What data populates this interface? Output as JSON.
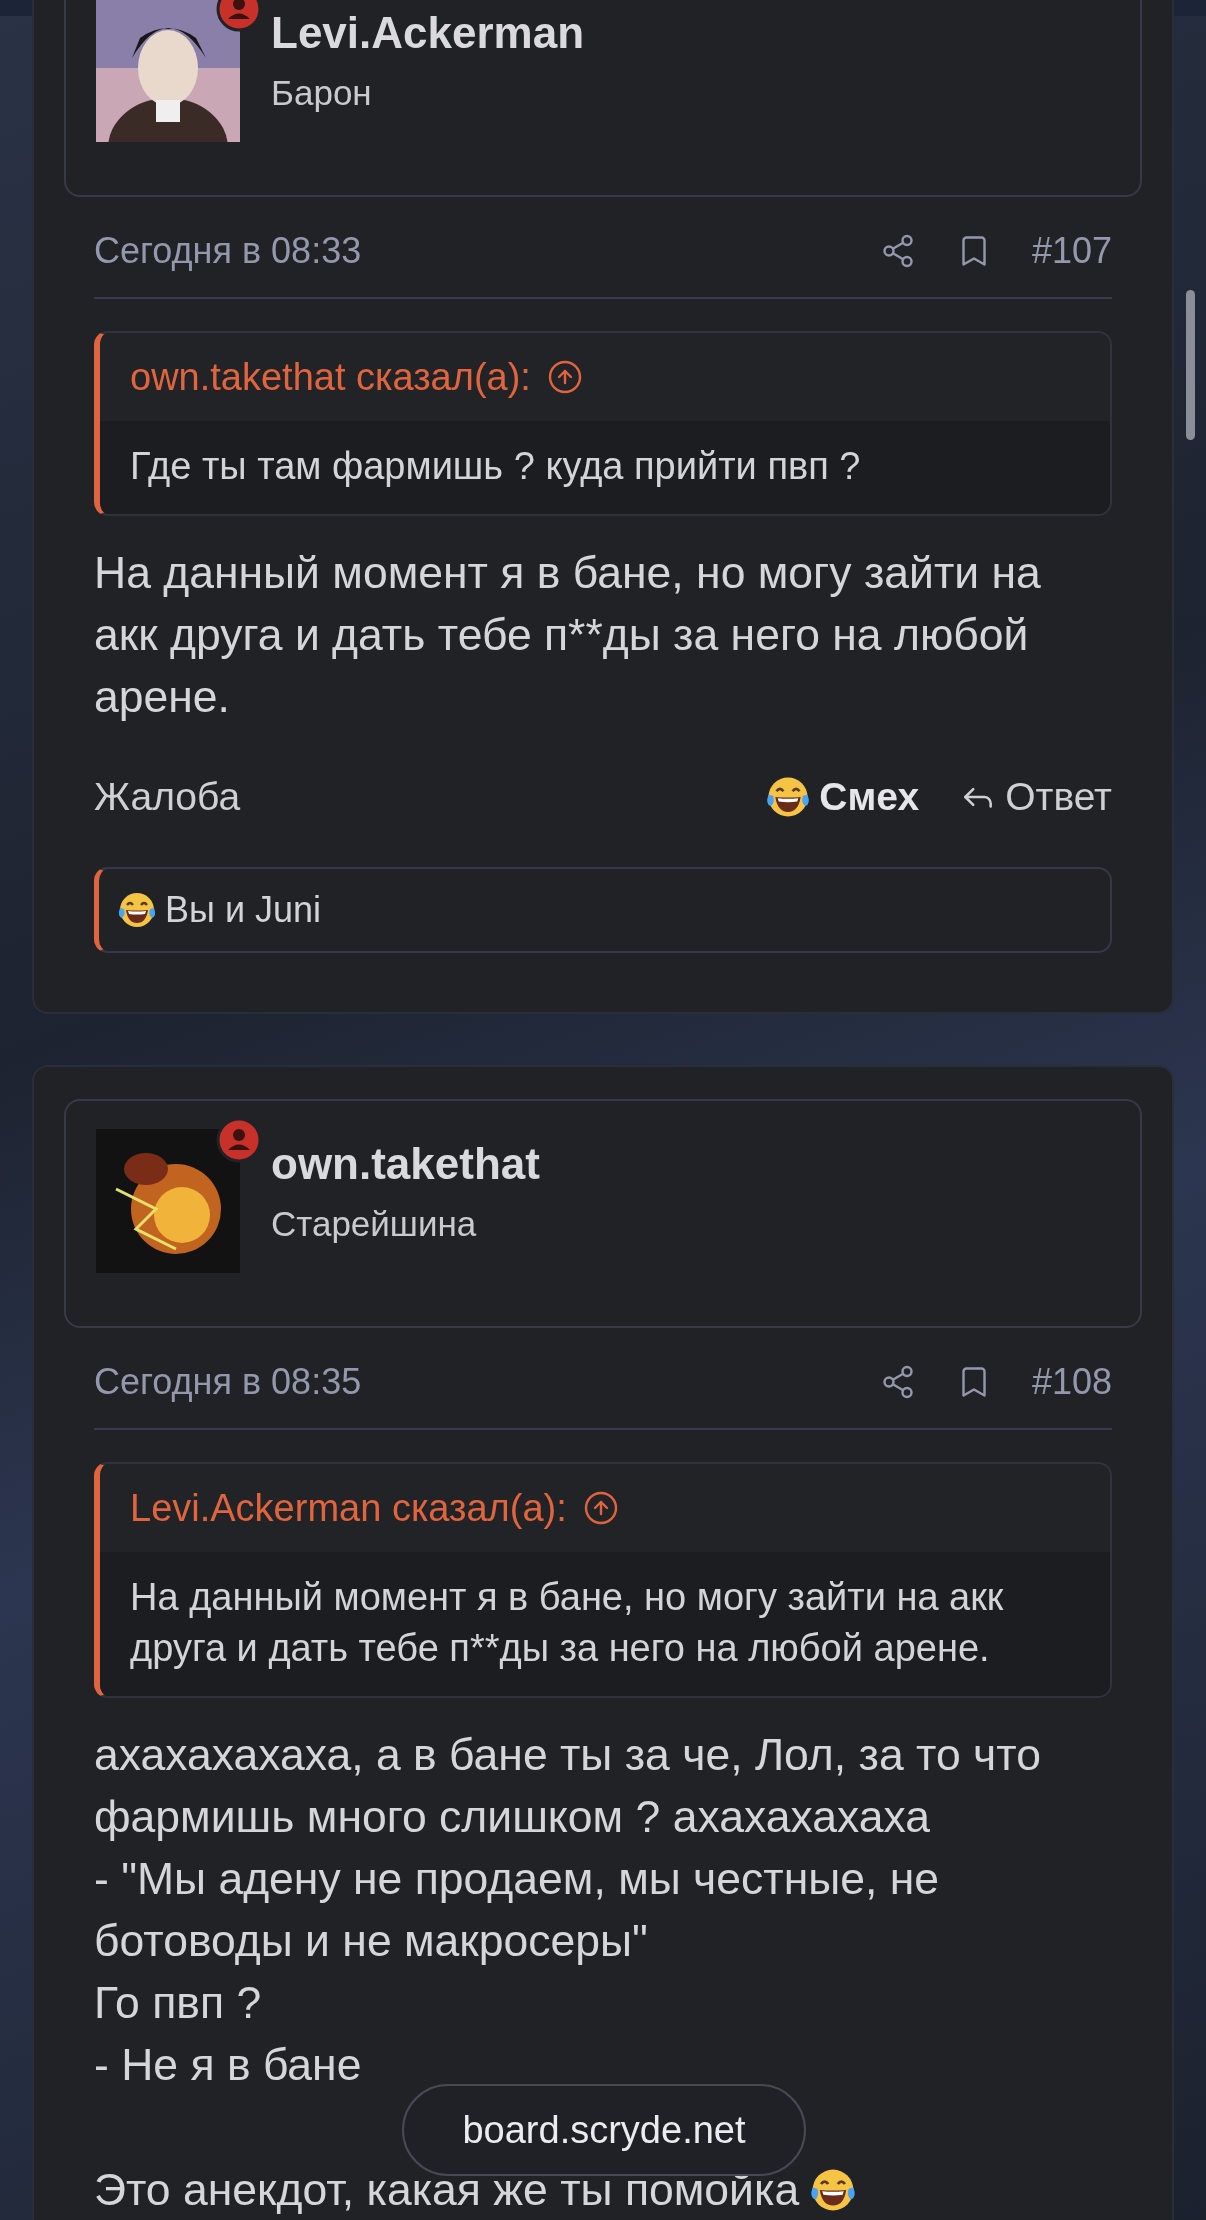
{
  "posts": [
    {
      "author": "Levi.Ackerman",
      "role": "Барон",
      "time": "Сегодня в 08:33",
      "number": "#107",
      "quote": {
        "header": "own.takethat сказал(а):",
        "lines": [
          "Где ты там фармишь ? куда прийти пвп ?"
        ]
      },
      "paragraphs": [
        [
          {
            "text": "На данный момент я в бане, но могу зайти на акк друга и дать тебе п**ды за него на любой арене."
          }
        ]
      ],
      "actions": [
        {
          "kind": "report",
          "label": "Жалоба"
        },
        {
          "kind": "reaction",
          "label": "Смех",
          "selected": true
        },
        {
          "kind": "reply",
          "label": "Ответ"
        }
      ],
      "reactions": {
        "text": "Вы и Juni"
      }
    },
    {
      "author": "own.takethat",
      "role": "Старейшина",
      "time": "Сегодня в 08:35",
      "number": "#108",
      "quote": {
        "header": "Levi.Ackerman сказал(а):",
        "lines": [
          "На данный момент я в бане, но могу зайти на акк",
          "друга и дать тебе п**ды за него на любой арене."
        ]
      },
      "paragraphs": [
        [
          {
            "text": "ахахахахаха, а в бане ты за че, Лол, за то что фармишь много слишком ? ахахахахаха"
          },
          {
            "text": "- \"Мы адену не продаем, мы честные, не ботоводы и не макросеры\""
          },
          {
            "text": "Го пвп ?"
          },
          {
            "text": "- Не я в бане"
          }
        ],
        [
          {
            "text": "Это анекдот, какая же ты помойка",
            "kind": "laughing"
          }
        ]
      ]
    }
  ],
  "url_bar": {
    "text": "board.scryde.net"
  }
}
